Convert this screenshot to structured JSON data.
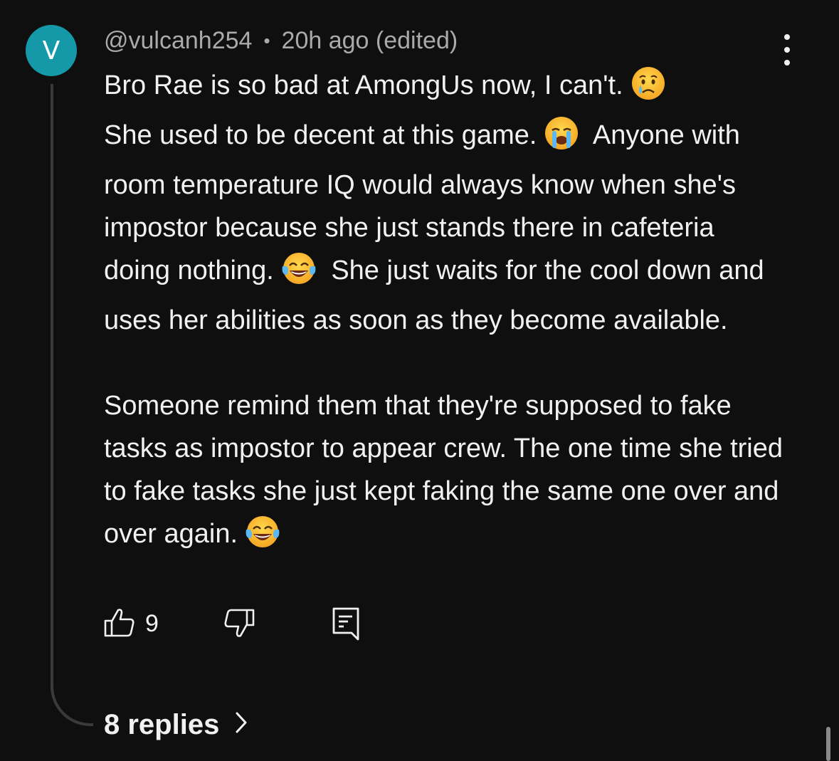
{
  "comment": {
    "avatar": {
      "letter": "V",
      "color": "#1598a8"
    },
    "username": "@vulcanh254",
    "separator": "•",
    "timestamp": "20h ago (edited)",
    "paragraph1": {
      "line1": "Bro Rae is so bad at AmongUs now, I can't.",
      "emoji1": "crying-face-emoji",
      "line2": "She used to be decent at this game.",
      "emoji2": "loudly-crying-face-emoji",
      "line3": "Anyone with room temperature IQ would always know when she's impostor because she just stands there in cafeteria doing nothing.",
      "emoji3": "face-with-tears-of-joy-emoji",
      "line4": "She just waits for the cool down and uses her abilities as soon as they become available."
    },
    "paragraph2": {
      "text": "Someone remind them that they're supposed to fake tasks as impostor to appear crew. The one time she tried to fake tasks she just kept faking the same one over and over again.",
      "emoji": "face-with-tears-of-joy-emoji"
    },
    "actions": {
      "like_icon": "thumbs-up-icon",
      "like_count": "9",
      "dislike_icon": "thumbs-down-icon",
      "reply_icon": "comment-reply-icon"
    },
    "replies_label": "8 replies",
    "replies_icon": "chevron-right-icon",
    "more_icon": "vertical-ellipsis-icon"
  },
  "colors": {
    "background": "#0f0f0f",
    "text_primary": "#f1f1f1",
    "text_secondary": "#aaaaaa",
    "thread_line": "#3a3a3a"
  }
}
